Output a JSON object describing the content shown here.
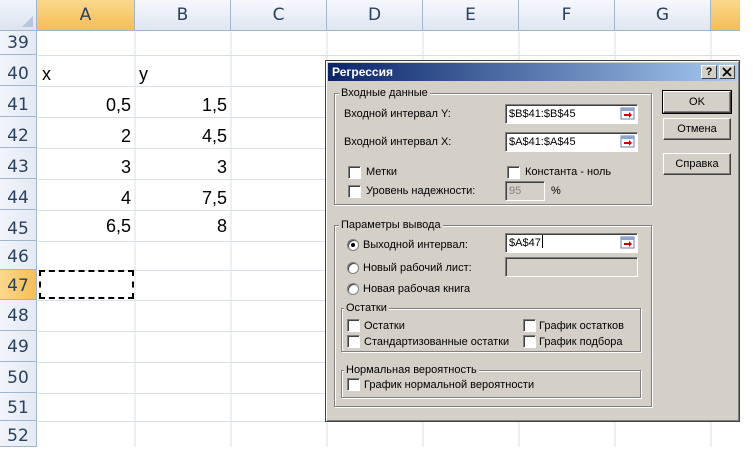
{
  "sheet": {
    "columns": [
      "A",
      "B",
      "C",
      "D",
      "E",
      "F",
      "G"
    ],
    "rows": [
      "39",
      "40",
      "41",
      "42",
      "43",
      "44",
      "45",
      "46",
      "47",
      "48",
      "49",
      "50",
      "51",
      "52"
    ],
    "cells": {
      "A40": "x",
      "B40": "y",
      "A41": "0,5",
      "B41": "1,5",
      "A42": "2",
      "B42": "4,5",
      "A43": "3",
      "B43": "3",
      "A44": "4",
      "B44": "7,5",
      "A45": "6,5",
      "B45": "8"
    },
    "active_cell": "A47",
    "colors": {
      "header_text": "#27415f",
      "grid": "#d8dfe9",
      "selected_header": "#f6bd55"
    }
  },
  "dialog": {
    "title": "Регрессия",
    "help_btn": "?",
    "close_btn": "X",
    "input_group": {
      "label": "Входные данные",
      "y_label": "Входной интервал Y:",
      "y_value": "$B$41:$B$45",
      "x_label": "Входной интервал X:",
      "x_value": "$A$41:$A$45",
      "labels_chk": "Метки",
      "const_chk": "Константа - ноль",
      "confidence_chk": "Уровень надежности:",
      "confidence_value": "95",
      "percent": "%"
    },
    "output_group": {
      "label": "Параметры вывода",
      "output_range": "Выходной интервал:",
      "output_value": "$A$47",
      "new_sheet": "Новый рабочий лист:",
      "new_book": "Новая рабочая книга"
    },
    "residuals_group": {
      "label": "Остатки",
      "residuals": "Остатки",
      "std_residuals": "Стандартизованные остатки",
      "residual_plot": "График остатков",
      "fit_plot": "График подбора"
    },
    "normal_group": {
      "label": "Нормальная вероятность",
      "normal_plot": "График нормальной вероятности"
    },
    "buttons": {
      "ok": "OK",
      "cancel": "Отмена",
      "help": "Справка"
    },
    "colors": {
      "face": "#d4d0c8",
      "title_start": "#0a246a",
      "title_end": "#a6caf0"
    }
  }
}
